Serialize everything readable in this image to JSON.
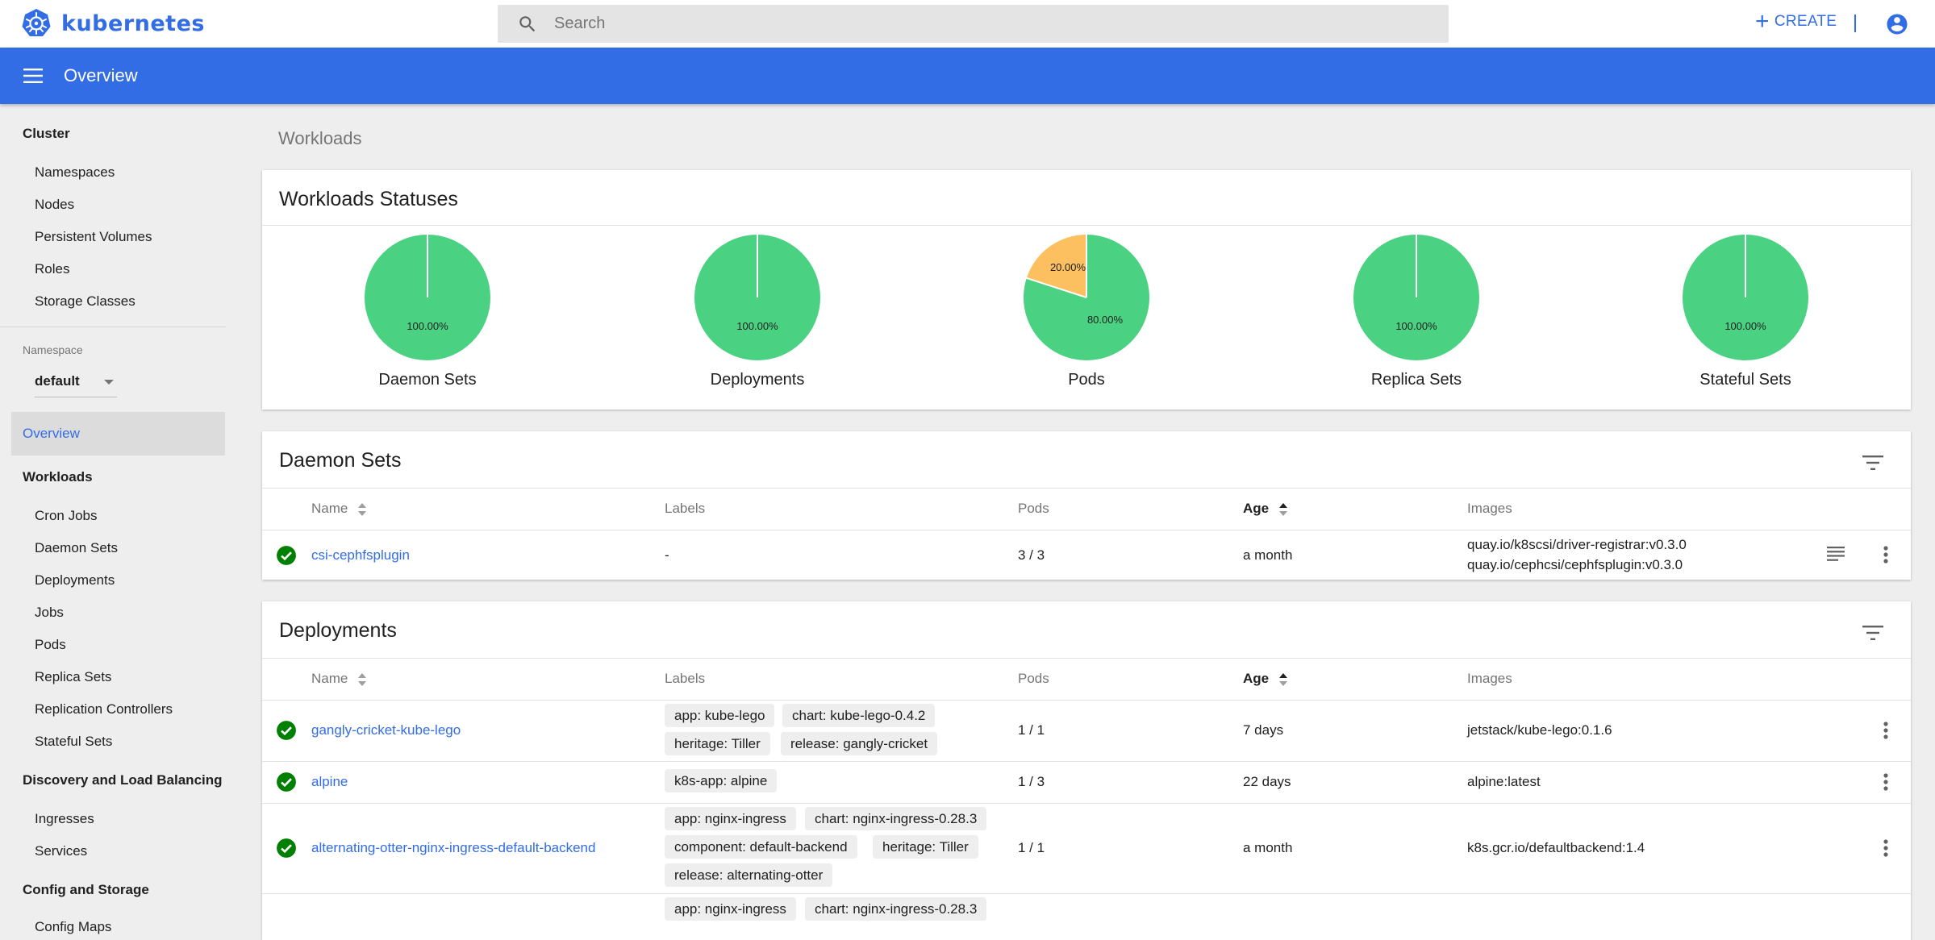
{
  "topbar": {
    "brand": "kubernetes",
    "search_placeholder": "Search",
    "create_label": "CREATE",
    "colors": {
      "brand": "#326de6"
    }
  },
  "header": {
    "title": "Overview"
  },
  "sidebar": {
    "cluster": {
      "title": "Cluster",
      "items": [
        "Namespaces",
        "Nodes",
        "Persistent Volumes",
        "Roles",
        "Storage Classes"
      ]
    },
    "namespace": {
      "label": "Namespace",
      "value": "default"
    },
    "overview": "Overview",
    "workloads": {
      "title": "Workloads",
      "items": [
        "Cron Jobs",
        "Daemon Sets",
        "Deployments",
        "Jobs",
        "Pods",
        "Replica Sets",
        "Replication Controllers",
        "Stateful Sets"
      ]
    },
    "discovery": {
      "title": "Discovery and Load Balancing",
      "items": [
        "Ingresses",
        "Services"
      ]
    },
    "config": {
      "title": "Config and Storage",
      "items": [
        "Config Maps"
      ]
    }
  },
  "main": {
    "section_title": "Workloads",
    "statuses": {
      "title": "Workloads Statuses",
      "colors": {
        "running": "#4ad282",
        "pending": "#fcc060"
      },
      "charts": [
        {
          "name": "Daemon Sets",
          "running": 100,
          "pending": 0,
          "running_label": "100.00%"
        },
        {
          "name": "Deployments",
          "running": 100,
          "pending": 0,
          "running_label": "100.00%"
        },
        {
          "name": "Pods",
          "running": 80,
          "pending": 20,
          "running_label": "80.00%",
          "pending_label": "20.00%"
        },
        {
          "name": "Replica Sets",
          "running": 100,
          "pending": 0,
          "running_label": "100.00%"
        },
        {
          "name": "Stateful Sets",
          "running": 100,
          "pending": 0,
          "running_label": "100.00%"
        }
      ]
    },
    "columns": {
      "name": "Name",
      "labels": "Labels",
      "pods": "Pods",
      "age": "Age",
      "images": "Images"
    },
    "daemon_sets": {
      "title": "Daemon Sets",
      "rows": [
        {
          "name": "csi-cephfsplugin",
          "labels": "-",
          "pods": "3 / 3",
          "age": "a month",
          "images": [
            "quay.io/k8scsi/driver-registrar:v0.3.0",
            "quay.io/cephcsi/cephfsplugin:v0.3.0"
          ]
        }
      ]
    },
    "deployments": {
      "title": "Deployments",
      "rows": [
        {
          "name": "gangly-cricket-kube-lego",
          "labels": [
            "app: kube-lego",
            "chart: kube-lego-0.4.2",
            "heritage: Tiller",
            "release: gangly-cricket"
          ],
          "pods": "1 / 1",
          "age": "7 days",
          "images": "jetstack/kube-lego:0.1.6"
        },
        {
          "name": "alpine",
          "labels": [
            "k8s-app: alpine"
          ],
          "pods": "1 / 3",
          "age": "22 days",
          "images": "alpine:latest"
        },
        {
          "name": "alternating-otter-nginx-ingress-default-backend",
          "labels": [
            "app: nginx-ingress",
            "chart: nginx-ingress-0.28.3",
            "component: default-backend",
            "heritage: Tiller",
            "release: alternating-otter"
          ],
          "pods": "1 / 1",
          "age": "a month",
          "images": "k8s.gcr.io/defaultbackend:1.4"
        },
        {
          "name": "",
          "labels": [
            "app: nginx-ingress",
            "chart: nginx-ingress-0.28.3"
          ],
          "pods": "",
          "age": "",
          "images": ""
        }
      ]
    }
  }
}
